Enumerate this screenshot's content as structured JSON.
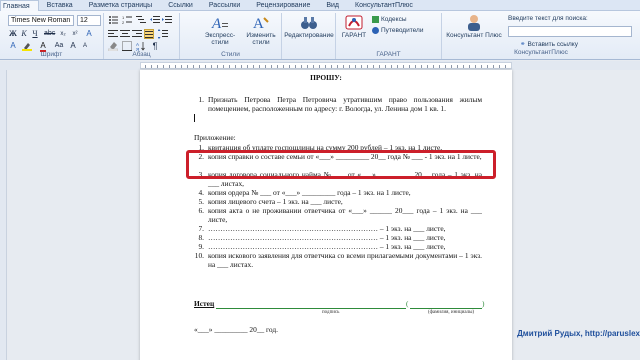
{
  "ribbon": {
    "tabs": [
      {
        "label": "Главная",
        "active": true
      },
      {
        "label": "Вставка"
      },
      {
        "label": "Разметка страницы"
      },
      {
        "label": "Ссылки"
      },
      {
        "label": "Рассылки"
      },
      {
        "label": "Рецензирование"
      },
      {
        "label": "Вид"
      },
      {
        "label": "КонсультантПлюс"
      }
    ],
    "font_name": "Times New Roman",
    "font_size": "12",
    "font_group_label": "Шрифт",
    "paragraph_group_label": "Абзац",
    "styles_group_label": "Стили",
    "styles": {
      "express_label": "Экспресс-стили",
      "change_label": "Изменить стили",
      "editing_label": "Редактирование"
    },
    "garant": {
      "label": "ГАРАНТ",
      "group_label": "ГАРАНТ",
      "codex": "Кодексы",
      "guides": "Путеводители"
    },
    "consultant": {
      "button_label": "Консультант Плюс",
      "search_label": "Введите текст для поиска:",
      "insert_link": "Вставить ссылку",
      "group_label": "КонсультантПлюс"
    },
    "colors": {
      "accent": "#1e395b",
      "highlight_red": "#cc1f2a",
      "watermark": "#1f4f9c"
    }
  },
  "document": {
    "title": "ПРОШУ:",
    "item1_num": "1.",
    "item1_text": "Признать Петрова Петра Петровича утратившим право пользования жилым помещением, расположенным по адресу: г. Вологда, ул. Ленина дом 1 кв. 1.",
    "appendix_label": "Приложение:",
    "items": [
      {
        "num": "1.",
        "text": "квитанция об уплате госпошлины на сумму 200 рублей – 1 экз. на 1 листе,"
      },
      {
        "num": "2.",
        "text": "копия справки о составе семьи от «___» _________ 20__ года № ___ - 1 экз. на 1 листе,"
      },
      {
        "num": "3.",
        "text": "копия договора социального найма № ___ от «___» _________ 20__ года – 1 экз. на ___ листах,"
      },
      {
        "num": "4.",
        "text": "копия ордера № ___ от «___» _________ года – 1 экз. на 1 листе,"
      },
      {
        "num": "5.",
        "text": "копия лицевого счета – 1 экз. на ___ листе,"
      },
      {
        "num": "6.",
        "text": "копия акта о не проживании ответчика от «___» ______ 20___ года – 1 экз. на ___ листе,"
      },
      {
        "num": "7.",
        "text": "…………………………………………………………… – 1 экз. на ___ листе,"
      },
      {
        "num": "8.",
        "text": "…………………………………………………………… – 1 экз. на ___ листе,"
      },
      {
        "num": "9.",
        "text": "…………………………………………………………… – 1 экз. на ___ листе,"
      },
      {
        "num": "10.",
        "text": "копия искового заявления для ответчика со всеми прилагаемыми документами – 1 экз. на ___ листах."
      }
    ],
    "istec": "Истец",
    "sign_caption": "подпись",
    "fio_caption": "(фамилия, инициалы)",
    "date_line": "«___» _________ 20__ год."
  },
  "watermark": "Дмитрий Рудых, http://parusleх"
}
